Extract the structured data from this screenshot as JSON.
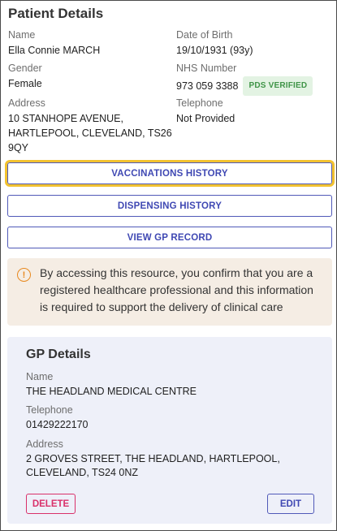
{
  "patient": {
    "title": "Patient Details",
    "name_label": "Name",
    "name": "Ella Connie MARCH",
    "dob_label": "Date of Birth",
    "dob": "19/10/1931 (93y)",
    "gender_label": "Gender",
    "gender": "Female",
    "nhs_label": "NHS Number",
    "nhs": "973 059 3388",
    "pds_badge": "PDS VERIFIED",
    "address_label": "Address",
    "address_line1": "10 STANHOPE AVENUE,",
    "address_line2": "HARTLEPOOL, CLEVELAND, TS26",
    "address_line3": "9QY",
    "telephone_label": "Telephone",
    "telephone": "Not Provided"
  },
  "actions": {
    "vaccinations": "VACCINATIONS HISTORY",
    "dispensing": "DISPENSING HISTORY",
    "gp_record": "VIEW GP RECORD"
  },
  "notice": {
    "icon": "warning-circle-icon",
    "text": "By accessing this resource, you confirm that you are a registered healthcare professional and this information is required to support the delivery of clinical care"
  },
  "gp": {
    "title": "GP Details",
    "name_label": "Name",
    "name": "THE HEADLAND MEDICAL CENTRE",
    "telephone_label": "Telephone",
    "telephone": "01429222170",
    "address_label": "Address",
    "address_line1": "2 GROVES STREET, THE HEADLAND, HARTLEPOOL,",
    "address_line2": "CLEVELAND, TS24 0NZ",
    "delete_label": "DELETE",
    "edit_label": "EDIT"
  },
  "colors": {
    "primary": "#3f48b3",
    "focus": "#f2c230",
    "danger": "#d9306a",
    "success": "#3f9447",
    "warning": "#e8891f"
  }
}
